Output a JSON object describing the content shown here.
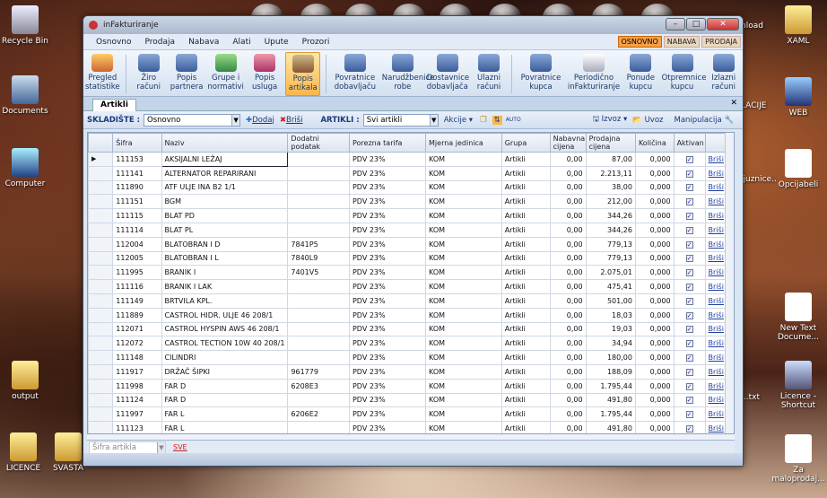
{
  "desktop": {
    "left_icons": [
      {
        "label": "Recycle Bin"
      },
      {
        "label": "Documents"
      },
      {
        "label": "Computer"
      },
      {
        "label": "output"
      },
      {
        "label": "LICENCE"
      },
      {
        "label": "SVASTA"
      }
    ],
    "right_icons": [
      {
        "label": "nload"
      },
      {
        "label": "XAML"
      },
      {
        "label": "LACIJE"
      },
      {
        "label": "WEB"
      },
      {
        "label": "ljuznice..."
      },
      {
        "label": "Opcijabeli"
      },
      {
        "label": "New Text Docume..."
      },
      {
        "label": "...txt"
      },
      {
        "label": "Licence - Shortcut"
      },
      {
        "label": "Za maloprodaj..."
      }
    ]
  },
  "window": {
    "title": "inFakturiranje",
    "controls": {
      "min": "–",
      "max": "□",
      "close": "✕"
    },
    "menu": [
      "Osnovno",
      "Prodaja",
      "Nabava",
      "Alati",
      "Upute",
      "Prozori"
    ],
    "right_tabs": [
      "OSNOVNO",
      "NABAVA",
      "PRODAJA"
    ],
    "ribbon": [
      {
        "label": "Pregled statistike"
      },
      {
        "label": "Žiro računi"
      },
      {
        "label": "Popis partnera"
      },
      {
        "label": "Grupe i normativi"
      },
      {
        "label": "Popis usluga"
      },
      {
        "label": "Popis artikala",
        "active": true
      },
      {
        "label": "Povratnice dobavljaču"
      },
      {
        "label": "Narudžbenice robe"
      },
      {
        "label": "Dostavnice dobavljača"
      },
      {
        "label": "Ulazni računi"
      },
      {
        "label": "Povratnice kupca"
      },
      {
        "label": "Periodično inFakturiranje"
      },
      {
        "label": "Ponude kupcu"
      },
      {
        "label": "Otpremnice kupcu"
      },
      {
        "label": "Izlazni računi"
      }
    ],
    "tab": "Artikli",
    "tab_close": "✕",
    "toolbar": {
      "skladiste_label": "SKLADIŠTE :",
      "skladiste_value": "Osnovno",
      "dodaj": "Dodaj",
      "brisi": "Briši",
      "artikli_label": "ARTIKLI :",
      "artikli_value": "Svi artikli",
      "akcije": "Akcije",
      "auto": "AUTO",
      "izvoz": "Izvoz",
      "uvoz": "Uvoz",
      "manipulacija": "Manipulacija"
    },
    "grid": {
      "columns": [
        "Šifra",
        "Naziv",
        "Dodatni podatak",
        "Porezna tarifa",
        "Mjerna jedinica",
        "Grupa",
        "Nabavna cijena",
        "Prodajna cijena",
        "Količina",
        "Aktivan",
        ""
      ],
      "rows": [
        [
          "111153",
          "AKSIJALNI LEŽAJ",
          "",
          "PDV 23%",
          "KOM",
          "Artikli",
          "0,00",
          "87,00",
          "0,000"
        ],
        [
          "111141",
          "ALTERNATOR REPARIRANI",
          "",
          "PDV 23%",
          "KOM",
          "Artikli",
          "0,00",
          "2.213,11",
          "0,000"
        ],
        [
          "111890",
          "ATF ULJE INA B2 1/1",
          "",
          "PDV 23%",
          "KOM",
          "Artikli",
          "0,00",
          "38,00",
          "0,000"
        ],
        [
          "111151",
          "BGM",
          "",
          "PDV 23%",
          "KOM",
          "Artikli",
          "0,00",
          "212,00",
          "0,000"
        ],
        [
          "111115",
          "BLAT PD",
          "",
          "PDV 23%",
          "KOM",
          "Artikli",
          "0,00",
          "344,26",
          "0,000"
        ],
        [
          "111114",
          "BLAT PL",
          "",
          "PDV 23%",
          "KOM",
          "Artikli",
          "0,00",
          "344,26",
          "0,000"
        ],
        [
          "112004",
          "BLATOBRAN I D",
          "7841P5",
          "PDV 23%",
          "KOM",
          "Artikli",
          "0,00",
          "779,13",
          "0,000"
        ],
        [
          "112005",
          "BLATOBRAN I L",
          "7840L9",
          "PDV 23%",
          "KOM",
          "Artikli",
          "0,00",
          "779,13",
          "0,000"
        ],
        [
          "111995",
          "BRANIK I",
          "7401V5",
          "PDV 23%",
          "KOM",
          "Artikli",
          "0,00",
          "2.075,01",
          "0,000"
        ],
        [
          "111116",
          "BRANIK I LAK",
          "",
          "PDV 23%",
          "KOM",
          "Artikli",
          "0,00",
          "475,41",
          "0,000"
        ],
        [
          "111149",
          "BRTVILA KPL.",
          "",
          "PDV 23%",
          "KOM",
          "Artikli",
          "0,00",
          "501,00",
          "0,000"
        ],
        [
          "111889",
          "CASTROL HIDR. ULJE 46 208/1",
          "",
          "PDV 23%",
          "KOM",
          "Artikli",
          "0,00",
          "18,03",
          "0,000"
        ],
        [
          "112071",
          "CASTROL HYSPIN AWS 46 208/1",
          "",
          "PDV 23%",
          "KOM",
          "Artikli",
          "0,00",
          "19,03",
          "0,000"
        ],
        [
          "112072",
          "CASTROL TECTION 10W 40 208/1",
          "",
          "PDV 23%",
          "KOM",
          "Artikli",
          "0,00",
          "34,94",
          "0,000"
        ],
        [
          "111148",
          "CILINDRI",
          "",
          "PDV 23%",
          "KOM",
          "Artikli",
          "0,00",
          "180,00",
          "0,000"
        ],
        [
          "111917",
          "DRŽAČ ŠIPKI",
          "961779",
          "PDV 23%",
          "KOM",
          "Artikli",
          "0,00",
          "188,09",
          "0,000"
        ],
        [
          "111998",
          "FAR D",
          "6208E3",
          "PDV 23%",
          "KOM",
          "Artikli",
          "0,00",
          "1.795,44",
          "0,000"
        ],
        [
          "111124",
          "FAR D",
          "",
          "PDV 23%",
          "KOM",
          "Artikli",
          "0,00",
          "491,80",
          "0,000"
        ],
        [
          "111997",
          "FAR L",
          "6206E2",
          "PDV 23%",
          "KOM",
          "Artikli",
          "0,00",
          "1.795,44",
          "0,000"
        ],
        [
          "111123",
          "FAR L",
          "",
          "PDV 23%",
          "KOM",
          "Artikli",
          "0,00",
          "491,80",
          "0,000"
        ]
      ],
      "row_link": "Briši"
    },
    "status": {
      "filter_placeholder": "Šifra artikla",
      "sve": "SVE"
    }
  }
}
